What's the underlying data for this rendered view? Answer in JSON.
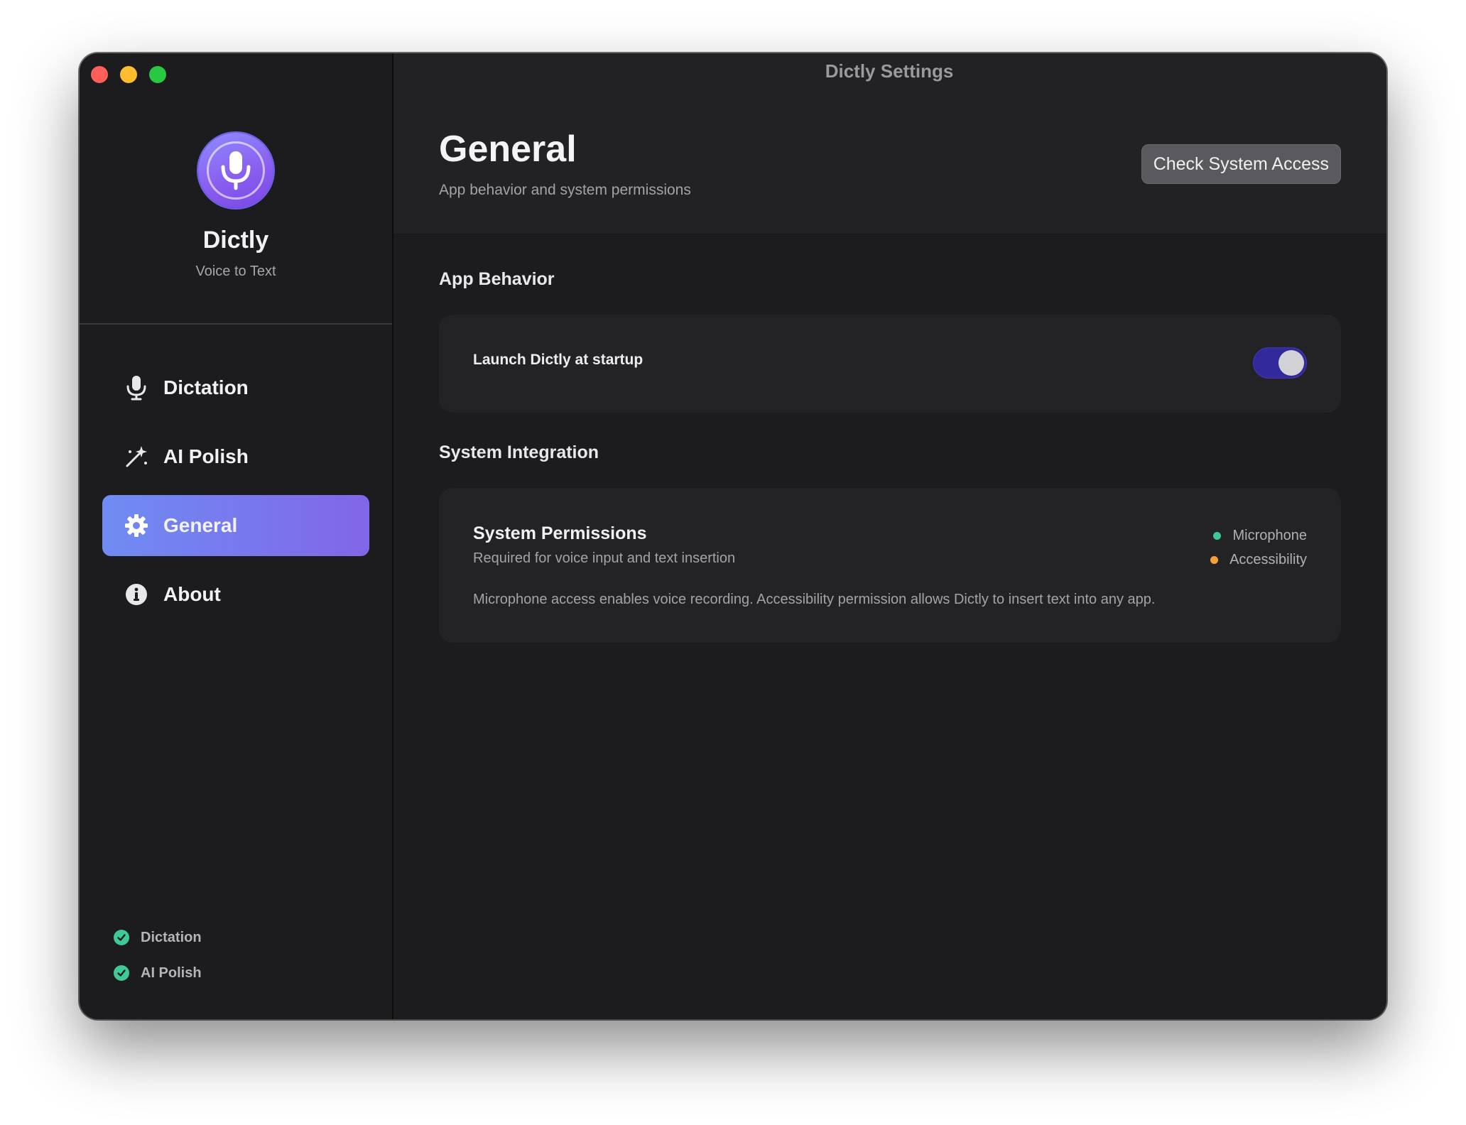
{
  "window": {
    "title": "Dictly Settings"
  },
  "sidebar": {
    "app_name": "Dictly",
    "app_subtitle": "Voice to Text",
    "items": [
      {
        "label": "Dictation",
        "icon": "microphone-icon",
        "active": false
      },
      {
        "label": "AI Polish",
        "icon": "magic-wand-icon",
        "active": false
      },
      {
        "label": "General",
        "icon": "gear-icon",
        "active": true
      },
      {
        "label": "About",
        "icon": "info-icon",
        "active": false
      }
    ],
    "status": [
      {
        "label": "Dictation",
        "icon": "check-circle-icon"
      },
      {
        "label": "AI Polish",
        "icon": "check-circle-icon"
      }
    ]
  },
  "main": {
    "title": "General",
    "subtitle": "App behavior and system permissions",
    "check_button": "Check System Access",
    "app_behavior": {
      "section_title": "App Behavior",
      "launch_label": "Launch Dictly at startup",
      "launch_enabled": true
    },
    "system_integration": {
      "section_title": "System Integration",
      "permissions_title": "System Permissions",
      "permissions_subtitle": "Required for voice input and text insertion",
      "permissions_description": "Microphone access enables voice recording. Accessibility permission allows Dictly to insert text into any app.",
      "statuses": [
        {
          "label": "Microphone",
          "color": "#3ec996"
        },
        {
          "label": "Accessibility",
          "color": "#f5a13a"
        }
      ]
    }
  },
  "colors": {
    "accent_start": "#6f8cf3",
    "accent_end": "#8166e8",
    "toggle_on": "#31299c",
    "ok_green": "#3ec996",
    "warn_orange": "#f5a13a"
  }
}
